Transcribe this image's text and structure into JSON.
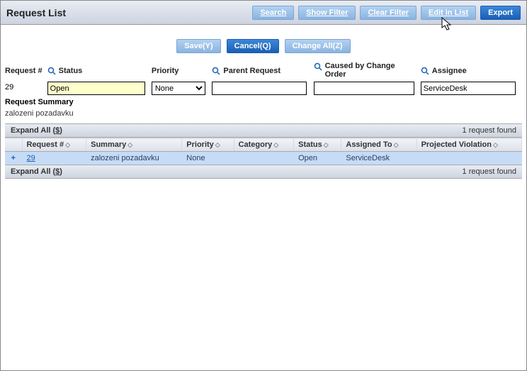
{
  "title": "Request List",
  "topButtons": {
    "search": "Search",
    "showFilter": "Show Filter",
    "clearFilter": "Clear Filter",
    "editInList": "Edit in List",
    "export": "Export"
  },
  "midButtons": {
    "save": "Save(Y)",
    "cancel": "Cancel(Q)",
    "changeAll": "Change All(Z)"
  },
  "fields": {
    "requestNum": {
      "label": "Request #",
      "value": "29"
    },
    "status": {
      "label": "Status",
      "value": "Open"
    },
    "priority": {
      "label": "Priority",
      "value": "None"
    },
    "parentRequest": {
      "label": "Parent Request",
      "value": ""
    },
    "causedByChange": {
      "label": "Caused by Change Order",
      "value": ""
    },
    "assignee": {
      "label": "Assignee",
      "value": "ServiceDesk"
    }
  },
  "summary": {
    "label": "Request Summary",
    "value": "zalozeni pozadavku"
  },
  "expandBar": {
    "label": "Expand All",
    "key": "$",
    "countText": "1 request found"
  },
  "columns": {
    "requestNum": "Request #",
    "summary": "Summary",
    "priority": "Priority",
    "category": "Category",
    "status": "Status",
    "assignedTo": "Assigned To",
    "projectedViolation": "Projected Violation"
  },
  "rows": [
    {
      "requestNum": "29",
      "summary": "zalozeni pozadavku",
      "priority": "None",
      "category": "",
      "status": "Open",
      "assignedTo": "ServiceDesk",
      "projectedViolation": ""
    }
  ]
}
